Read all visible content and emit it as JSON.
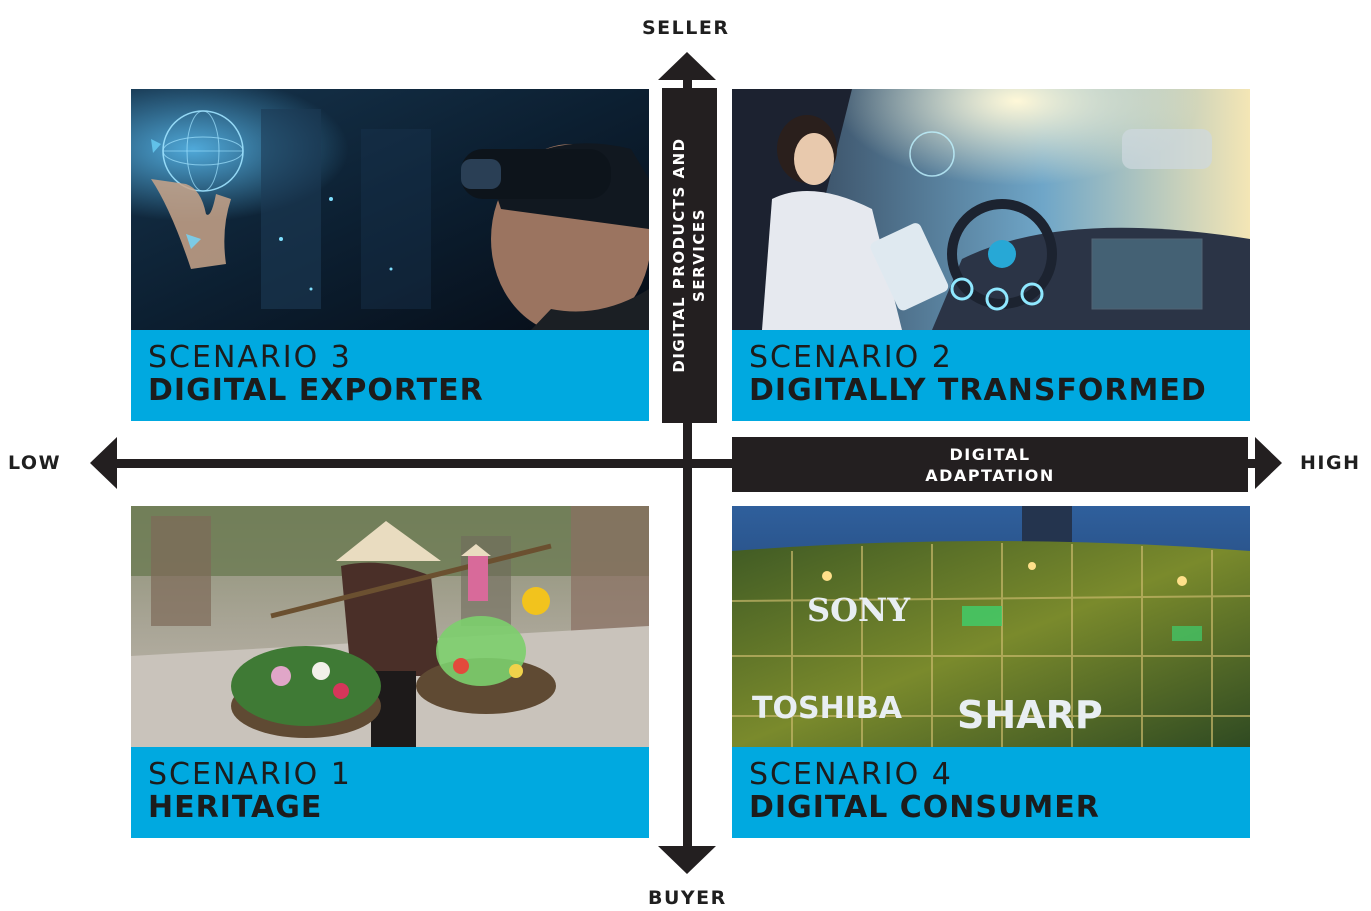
{
  "axes": {
    "top": "SELLER",
    "bottom": "BUYER",
    "left": "LOW",
    "right": "HIGH",
    "vertical_label": [
      "DIGITAL PRODUCTS AND",
      "SERVICES"
    ],
    "horizontal_label": [
      "DIGITAL",
      "ADAPTATION"
    ]
  },
  "quadrants": {
    "top_left": {
      "scenario": "SCENARIO 3",
      "name": "DIGITAL EXPORTER",
      "photo": "person wearing mixed-reality headset touching holographic globe"
    },
    "top_right": {
      "scenario": "SCENARIO 2",
      "name": "DIGITALLY TRANSFORMED",
      "photo": "woman reading in a self-driving car with holographic dashboard"
    },
    "bottom_left": {
      "scenario": "SCENARIO 1",
      "name": "HERITAGE",
      "photo": "street vendor in conical hat carrying flower baskets"
    },
    "bottom_right": {
      "scenario": "SCENARIO 4",
      "name": "DIGITAL CONSUMER",
      "photo": "glass building facade with illuminated electronics brand signs"
    }
  },
  "signs": [
    "SONY",
    "TOSHIBA",
    "SHARP"
  ],
  "colors": {
    "caption_bg": "#00a9e0",
    "axis": "#231f20",
    "text": "#1c1c1c"
  }
}
